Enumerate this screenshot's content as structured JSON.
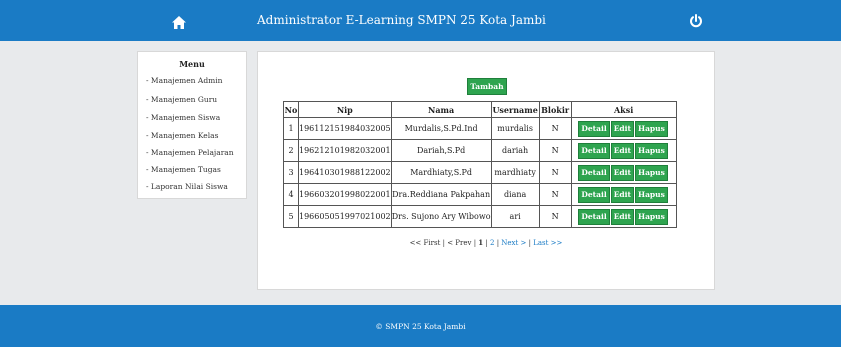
{
  "header": {
    "title": "Administrator E-Learning SMPN 25 Kota Jambi"
  },
  "sidebar": {
    "title": "Menu",
    "items": [
      {
        "label": "- Manajemen Admin"
      },
      {
        "label": "- Manajemen Guru"
      },
      {
        "label": "- Manajemen Siswa"
      },
      {
        "label": "- Manajemen Kelas"
      },
      {
        "label": "- Manajemen Pelajaran"
      },
      {
        "label": "- Manajemen Tugas"
      },
      {
        "label": "- Laporan Nilai Siswa"
      }
    ]
  },
  "main": {
    "add_label": "Tambah",
    "columns": [
      "No",
      "Nip",
      "Nama",
      "Username",
      "Blokir",
      "Aksi"
    ],
    "rows": [
      {
        "no": "1",
        "nip": "196112151984032005",
        "nama": "Murdalis,S.Pd.Ind",
        "username": "murdalis",
        "blokir": "N"
      },
      {
        "no": "2",
        "nip": "196212101982032001",
        "nama": "Dariah,S.Pd",
        "username": "dariah",
        "blokir": "N"
      },
      {
        "no": "3",
        "nip": "196410301988122002",
        "nama": "Mardhiaty,S.Pd",
        "username": "mardhiaty",
        "blokir": "N"
      },
      {
        "no": "4",
        "nip": "196603201998022001",
        "nama": "Dra.Reddiana Pakpahan",
        "username": "diana",
        "blokir": "N"
      },
      {
        "no": "5",
        "nip": "196605051997021002",
        "nama": "Drs. Sujono Ary Wibowo",
        "username": "ari",
        "blokir": "N"
      }
    ],
    "actions": {
      "detail": "Detail",
      "edit": "Edit",
      "hapus": "Hapus"
    },
    "pagination": {
      "first": "<< First",
      "sep": "|",
      "prev": "< Prev",
      "current": "1",
      "page2": "2",
      "next": "Next >",
      "last": "Last >>"
    }
  },
  "footer": {
    "text": "© SMPN 25 Kota Jambi"
  },
  "colors": {
    "header_bg": "#1a7bc5",
    "button_green": "#2ea44f"
  },
  "icons": {
    "home": "home-icon",
    "power": "power-icon"
  }
}
